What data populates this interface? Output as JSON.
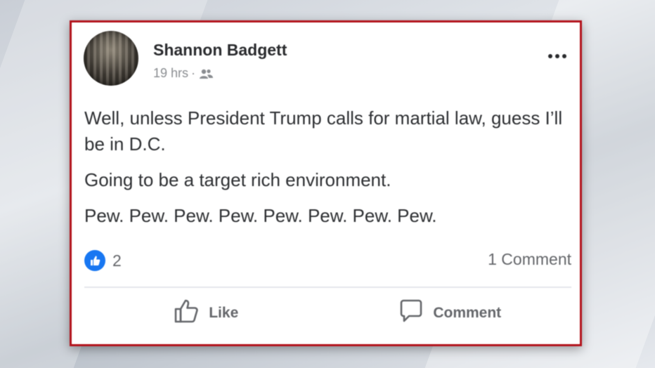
{
  "post": {
    "author": "Shannon Badgett",
    "time": "19 hrs",
    "separator": "·",
    "audience_icon": "friends-icon",
    "menu_icon": "more-options-icon",
    "paragraphs": [
      "Well, unless President Trump calls for martial law, guess I’ll be in D.C.",
      "Going to be a target rich environment.",
      "Pew. Pew. Pew. Pew. Pew. Pew. Pew. Pew."
    ],
    "reactions": {
      "icon": "like-reaction-icon",
      "count": "2"
    },
    "comments_label": "1 Comment",
    "actions": {
      "like_label": "Like",
      "like_icon": "thumbs-up-icon",
      "comment_label": "Comment",
      "comment_icon": "comment-bubble-icon"
    }
  },
  "colors": {
    "frame_border": "#b3121b",
    "like_blue": "#1877f2",
    "muted_text": "#65676b"
  }
}
